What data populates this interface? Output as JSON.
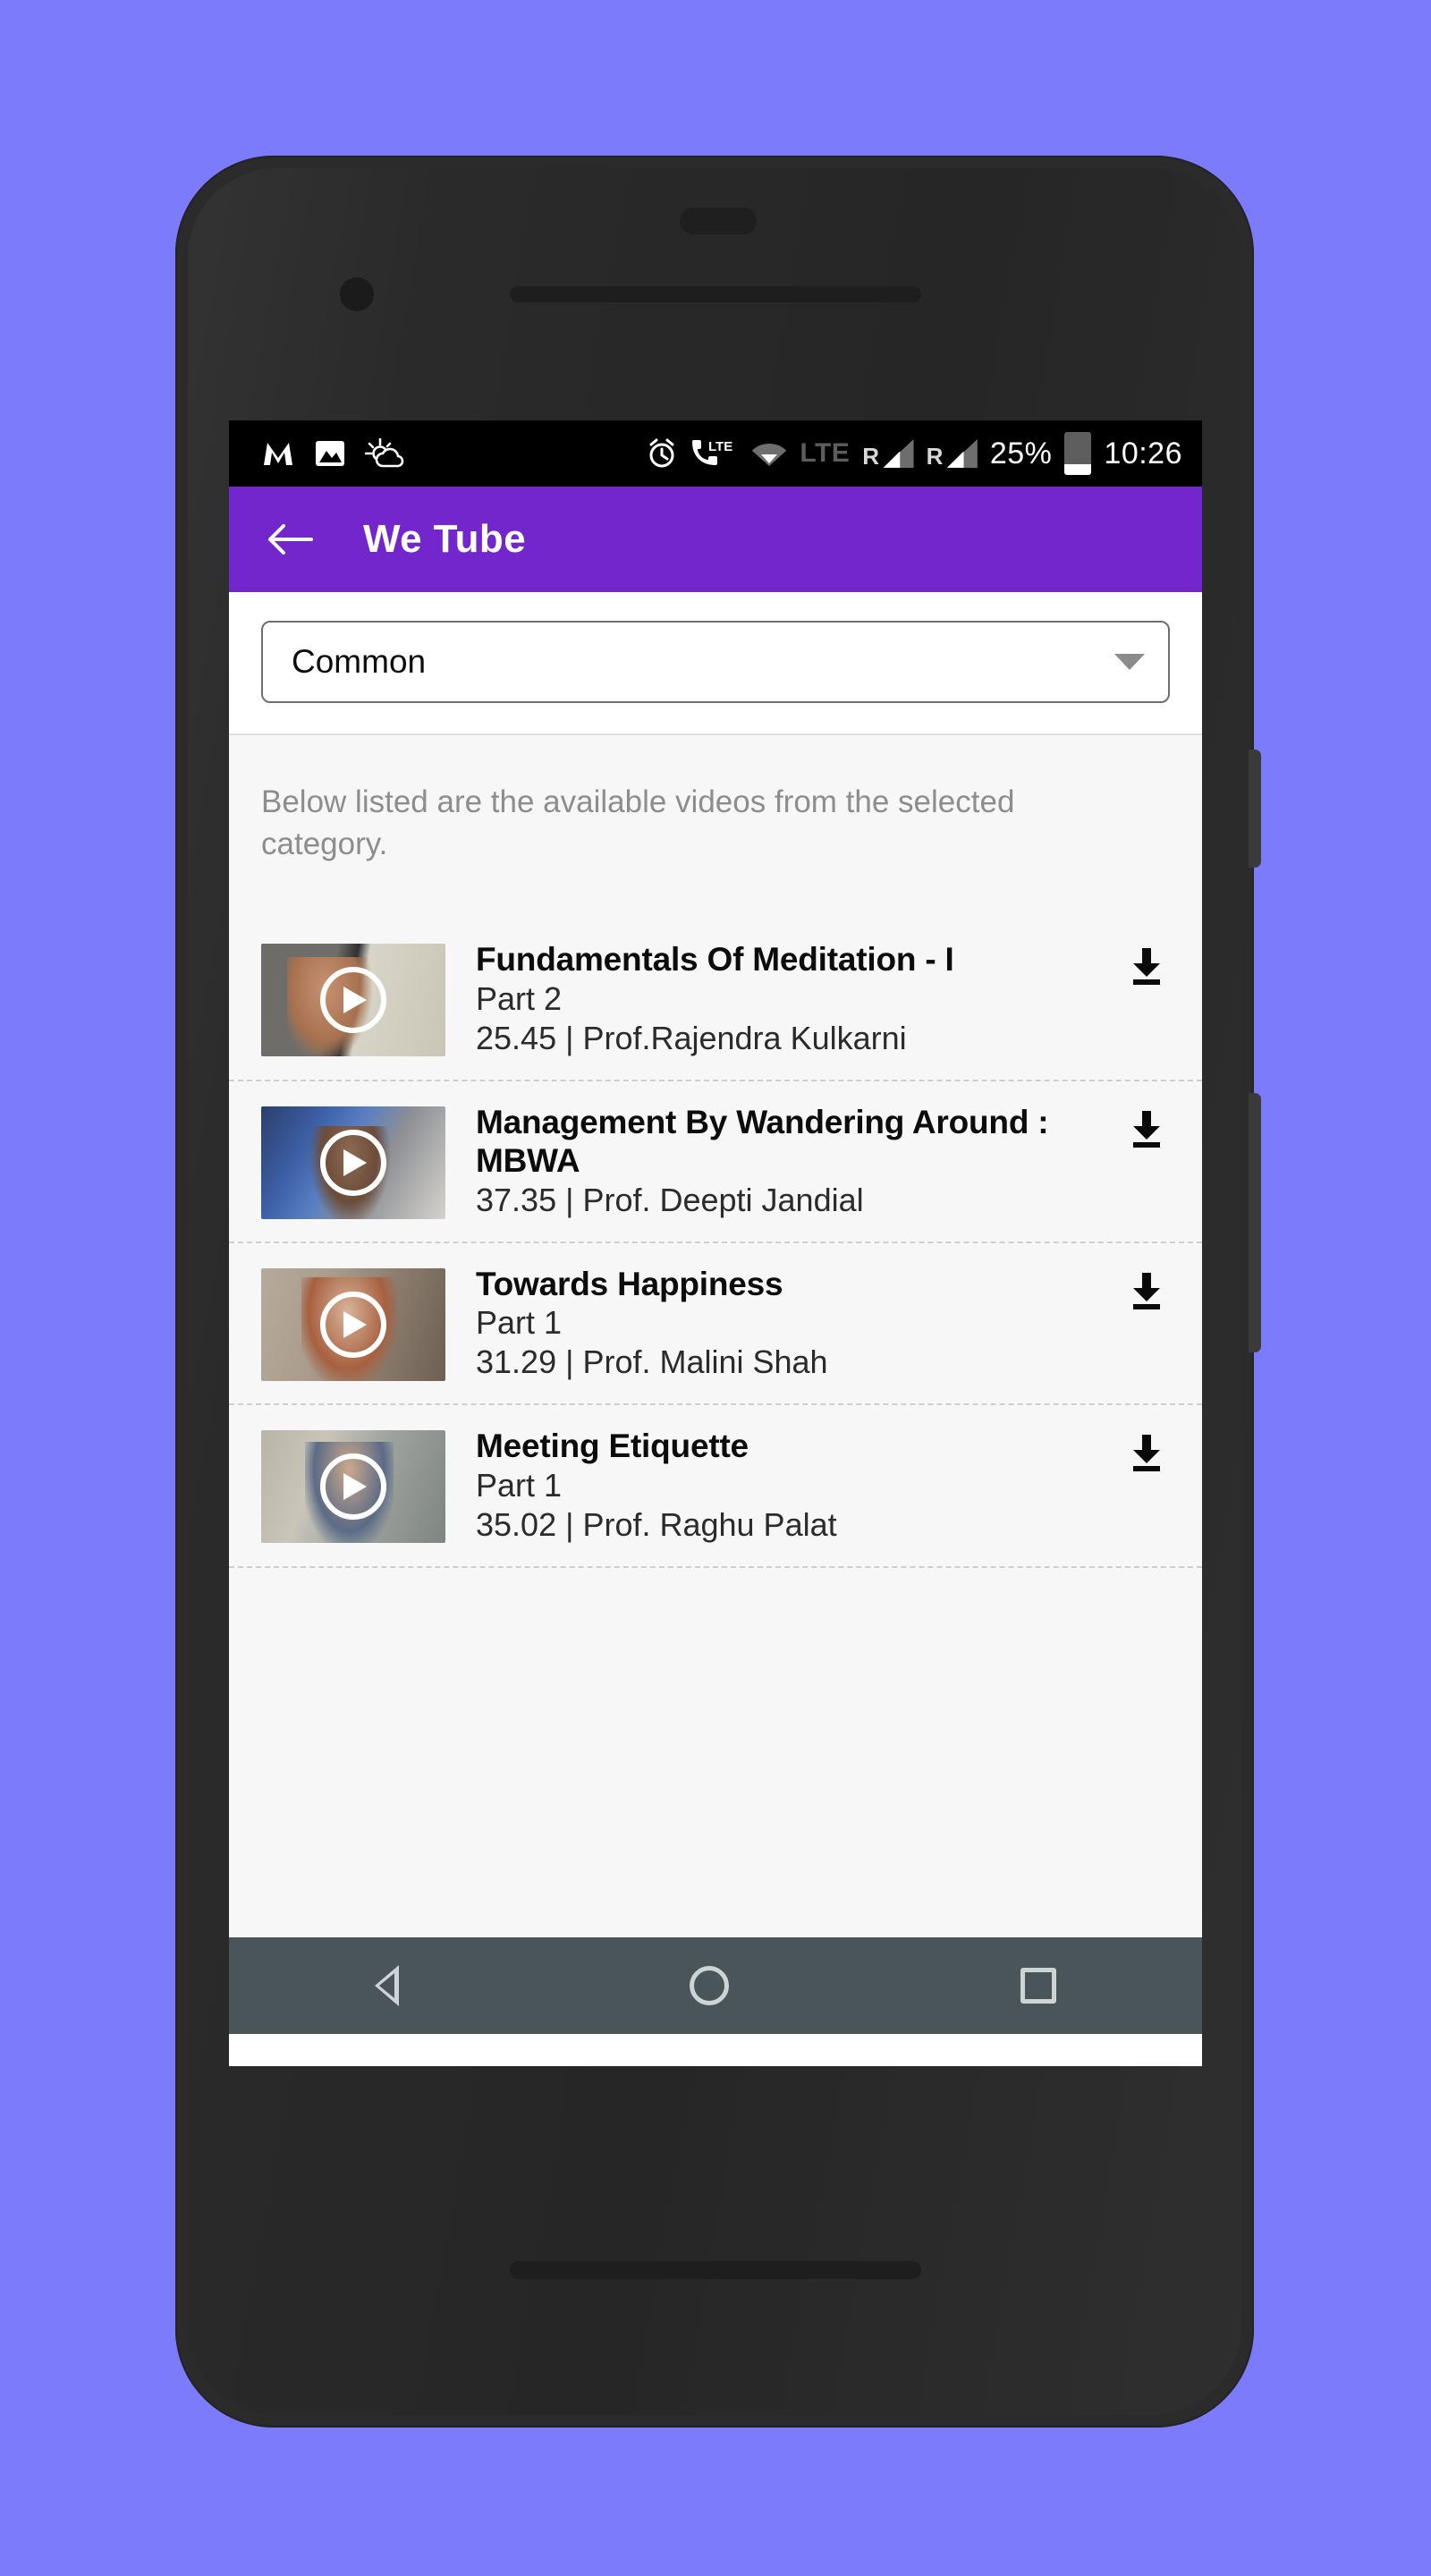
{
  "statusbar": {
    "icons_left": [
      "mail-m-icon",
      "gallery-image-icon",
      "weather-partly-cloudy-icon"
    ],
    "alarm_icon": "alarm-clock-icon",
    "call_lte_icon": "call-lte-icon",
    "wifi_icon": "wifi-icon",
    "lte_label": "LTE",
    "roaming_label_1": "R",
    "roaming_label_2": "R",
    "battery_percent": "25%",
    "battery_icon": "battery-icon",
    "time": "10:26"
  },
  "appbar": {
    "back_icon": "arrow-back-icon",
    "title": "We Tube",
    "background_color": "#7226cc"
  },
  "spinner": {
    "selected": "Common",
    "caret_icon": "chevron-down-icon"
  },
  "hint": "Below listed are the available videos from the selected category.",
  "videos": [
    {
      "title": "Fundamentals Of Meditation - I",
      "part": "Part 2",
      "subtitle": "25.45 | Prof.Rajendra Kulkarni",
      "play_icon": "play-circle-icon",
      "download_icon": "download-icon"
    },
    {
      "title": "Management By Wandering Around : MBWA",
      "part": "",
      "subtitle": "37.35 | Prof. Deepti Jandial",
      "play_icon": "play-circle-icon",
      "download_icon": "download-icon"
    },
    {
      "title": "Towards Happiness",
      "part": "Part 1",
      "subtitle": "31.29 | Prof. Malini Shah",
      "play_icon": "play-circle-icon",
      "download_icon": "download-icon"
    },
    {
      "title": "Meeting Etiquette",
      "part": "Part 1",
      "subtitle": "35.02 | Prof. Raghu Palat",
      "play_icon": "play-circle-icon",
      "download_icon": "download-icon"
    }
  ],
  "navbar": {
    "back_icon": "nav-back-triangle-icon",
    "home_icon": "nav-home-circle-icon",
    "recents_icon": "nav-recents-square-icon",
    "background_color": "#4a555a"
  }
}
